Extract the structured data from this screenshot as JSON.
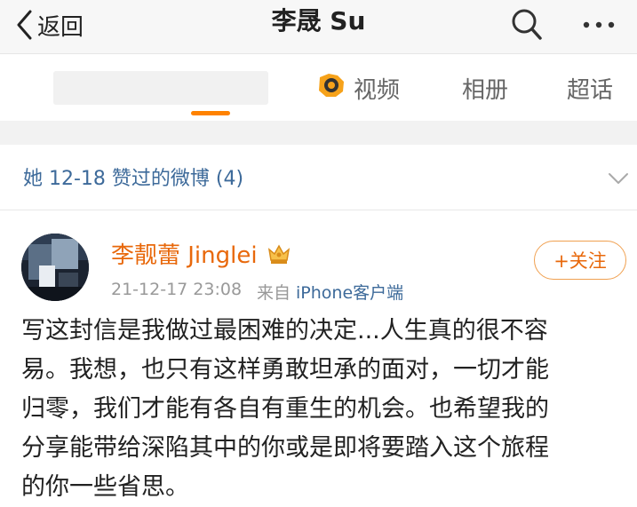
{
  "nav": {
    "back_label": "返回",
    "title": "李晟 Su",
    "search_icon": "search-icon",
    "more_icon": "more-dots-icon"
  },
  "tabs": {
    "active_tab": "redacted",
    "items": [
      {
        "label": "视频",
        "icon": "video-icon"
      },
      {
        "label": "相册"
      },
      {
        "label": "超话"
      }
    ]
  },
  "liked_section": {
    "header_text": "她 12-18 赞过的微博 (4)",
    "chevron_icon": "chevron-down-icon"
  },
  "post": {
    "author": "李靓蕾 Jinglei",
    "vip_badge_icon": "crown-badge-icon",
    "time": "21-12-17 23:08",
    "source_prefix": "来自",
    "source_client": "iPhone客户端",
    "follow_label": "+关注",
    "body_lines": [
      "写这封信是我做过最困难的决定...人生真的很不容",
      "易。我想，也只有这样勇敢坦承的面对，一切才能",
      "归零，我们才能有各自有重生的机会。也希望我的",
      "分享能带给深陷其中的你或是即将要踏入这个旅程",
      "的你一些省思。"
    ]
  },
  "colors": {
    "accent_orange": "#ff8200",
    "author_orange": "#e8680b",
    "link_blue": "#3d6a9a",
    "nav_bg": "#f7f7f7",
    "gap_bg": "#f2f2f2"
  }
}
